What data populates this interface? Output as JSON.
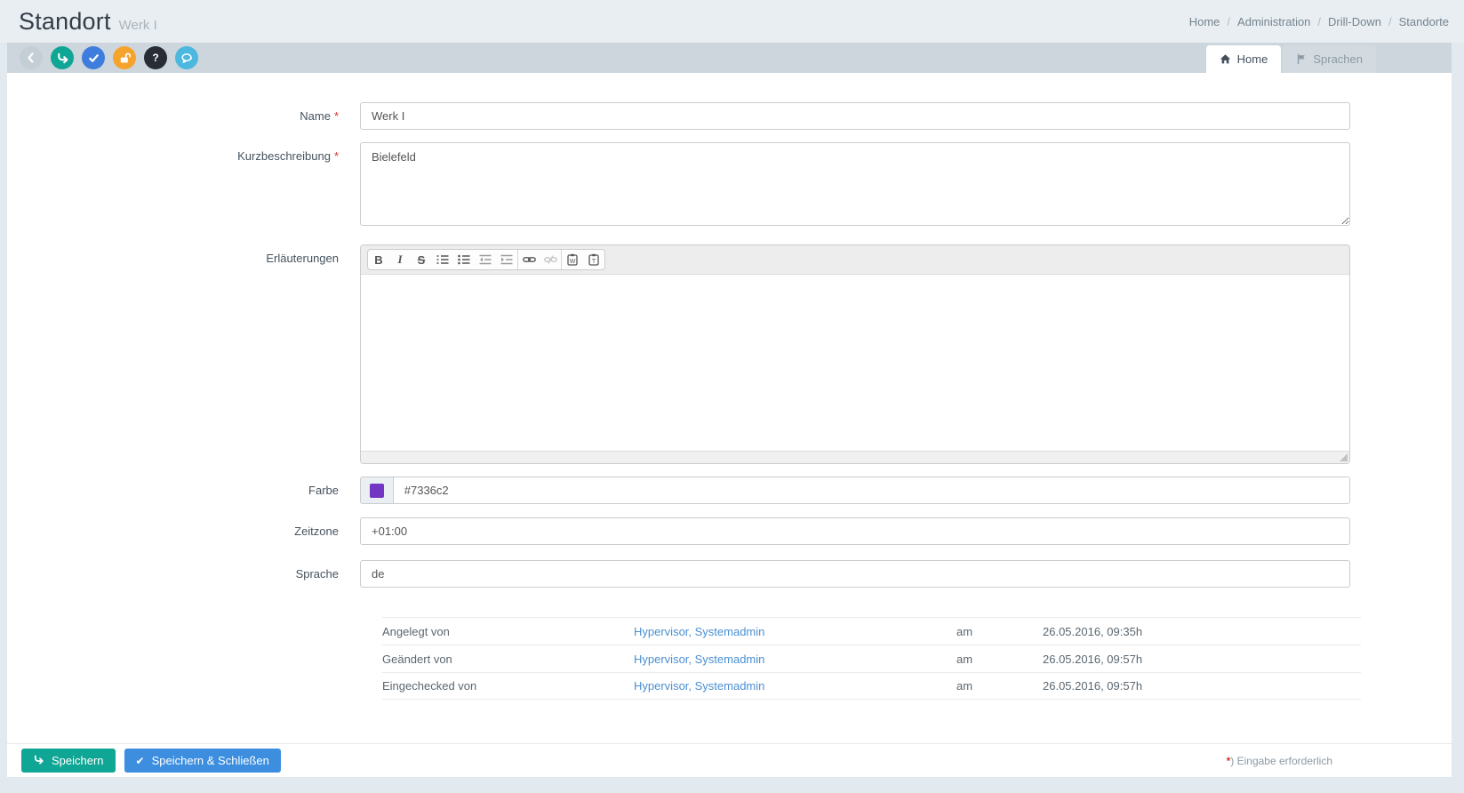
{
  "header": {
    "title": "Standort",
    "subtitle": "Werk I",
    "breadcrumb": [
      "Home",
      "Administration",
      "Drill-Down",
      "Standorte"
    ],
    "breadcrumb_separator": "/"
  },
  "toolbar": {
    "icons": [
      "back-icon",
      "save-arrow-icon",
      "check-icon",
      "unlock-icon",
      "help-icon",
      "comments-icon"
    ],
    "help_glyph": "?"
  },
  "tabs": [
    {
      "label": "Home",
      "icon": "home-icon",
      "active": true
    },
    {
      "label": "Sprachen",
      "icon": "flag-icon",
      "active": false
    }
  ],
  "form": {
    "required_marker": "*",
    "fields": {
      "name": {
        "label": "Name",
        "required": true,
        "value": "Werk I"
      },
      "kurzbeschreibung": {
        "label": "Kurzbeschreibung",
        "required": true,
        "value": "Bielefeld"
      },
      "erlaeuterungen": {
        "label": "Erläuterungen",
        "value": ""
      },
      "farbe": {
        "label": "Farbe",
        "value": "#7336c2",
        "swatch_color": "#7336c2"
      },
      "zeitzone": {
        "label": "Zeitzone",
        "value": "+01:00"
      },
      "sprache": {
        "label": "Sprache",
        "value": "de"
      }
    }
  },
  "editor": {
    "toolbar": {
      "bold": "B",
      "italic": "I",
      "strike": "S",
      "paste_word_letter": "W",
      "paste_text_letter": "T",
      "icons": [
        "ordered-list",
        "unordered-list",
        "outdent",
        "indent",
        "link",
        "unlink",
        "paste-word",
        "paste-text"
      ]
    },
    "value": ""
  },
  "audit": {
    "rows": [
      {
        "label": "Angelegt von",
        "user": "Hypervisor, Systemadmin",
        "preposition": "am",
        "timestamp": "26.05.2016, 09:35h"
      },
      {
        "label": "Geändert von",
        "user": "Hypervisor, Systemadmin",
        "preposition": "am",
        "timestamp": "26.05.2016, 09:57h"
      },
      {
        "label": "Eingechecked von",
        "user": "Hypervisor, Systemadmin",
        "preposition": "am",
        "timestamp": "26.05.2016, 09:57h"
      }
    ]
  },
  "footer": {
    "save_label": "Speichern",
    "save_close_label": "Speichern & Schließen",
    "save_close_check": "✔",
    "required_note_star": "*",
    "required_note_text": ") Eingabe erforderlich"
  },
  "colors": {
    "accent_teal": "#10a695",
    "accent_blue": "#3d8edf",
    "accent_orange": "#f6a32d",
    "accent_dark": "#272c35",
    "accent_lightblue": "#4cb8e0",
    "swatch": "#7336c2",
    "link_blue": "#4a90d2",
    "required_red": "#d9302c"
  }
}
